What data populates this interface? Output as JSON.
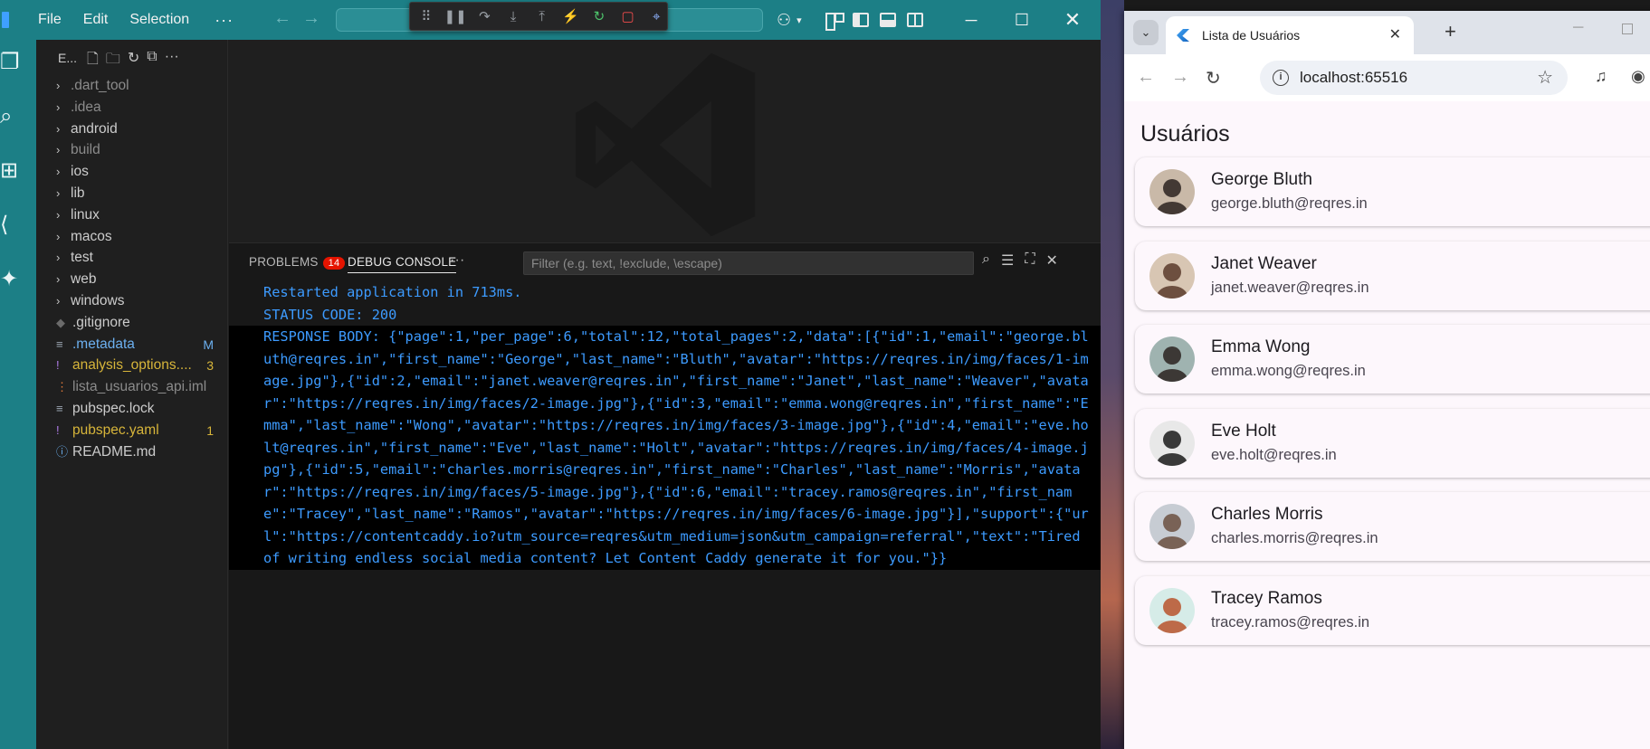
{
  "vscode": {
    "menu": [
      "File",
      "Edit",
      "Selection"
    ],
    "explorer_title": "E...",
    "tree": [
      {
        "label": ".dart_tool",
        "kind": "folder",
        "state": "dim"
      },
      {
        "label": ".idea",
        "kind": "folder",
        "state": "dim"
      },
      {
        "label": "android",
        "kind": "folder",
        "state": ""
      },
      {
        "label": "build",
        "kind": "folder",
        "state": "dim"
      },
      {
        "label": "ios",
        "kind": "folder",
        "state": ""
      },
      {
        "label": "lib",
        "kind": "folder",
        "state": ""
      },
      {
        "label": "linux",
        "kind": "folder",
        "state": ""
      },
      {
        "label": "macos",
        "kind": "folder",
        "state": ""
      },
      {
        "label": "test",
        "kind": "folder",
        "state": ""
      },
      {
        "label": "web",
        "kind": "folder",
        "state": ""
      },
      {
        "label": "windows",
        "kind": "folder",
        "state": ""
      },
      {
        "label": ".gitignore",
        "kind": "file",
        "icon": "diamond-icon",
        "state": ""
      },
      {
        "label": ".metadata",
        "kind": "file",
        "icon": "lines-icon",
        "state": "mod",
        "badge": "M"
      },
      {
        "label": "analysis_options....",
        "kind": "file",
        "icon": "exclamation-icon",
        "state": "warn",
        "badge": "3"
      },
      {
        "label": "lista_usuarios_api.iml",
        "kind": "file",
        "icon": "rss-icon",
        "state": "dim"
      },
      {
        "label": "pubspec.lock",
        "kind": "file",
        "icon": "lines-icon",
        "state": ""
      },
      {
        "label": "pubspec.yaml",
        "kind": "file",
        "icon": "exclamation-icon",
        "state": "warn",
        "badge": "1"
      },
      {
        "label": "README.md",
        "kind": "file",
        "icon": "info-icon",
        "state": ""
      }
    ],
    "panel": {
      "problems_label": "PROBLEMS",
      "problems_count": "14",
      "debug_console_label": "DEBUG CONSOLE",
      "filter_placeholder": "Filter (e.g. text, !exclude, \\escape)",
      "console_lines": [
        "Restarted application in 713ms.",
        "STATUS CODE: 200"
      ],
      "response_body": "RESPONSE BODY: {\"page\":1,\"per_page\":6,\"total\":12,\"total_pages\":2,\"data\":[{\"id\":1,\"email\":\"george.bluth@reqres.in\",\"first_name\":\"George\",\"last_name\":\"Bluth\",\"avatar\":\"https://reqres.in/img/faces/1-image.jpg\"},{\"id\":2,\"email\":\"janet.weaver@reqres.in\",\"first_name\":\"Janet\",\"last_name\":\"Weaver\",\"avatar\":\"https://reqres.in/img/faces/2-image.jpg\"},{\"id\":3,\"email\":\"emma.wong@reqres.in\",\"first_name\":\"Emma\",\"last_name\":\"Wong\",\"avatar\":\"https://reqres.in/img/faces/3-image.jpg\"},{\"id\":4,\"email\":\"eve.holt@reqres.in\",\"first_name\":\"Eve\",\"last_name\":\"Holt\",\"avatar\":\"https://reqres.in/img/faces/4-image.jpg\"},{\"id\":5,\"email\":\"charles.morris@reqres.in\",\"first_name\":\"Charles\",\"last_name\":\"Morris\",\"avatar\":\"https://reqres.in/img/faces/5-image.jpg\"},{\"id\":6,\"email\":\"tracey.ramos@reqres.in\",\"first_name\":\"Tracey\",\"last_name\":\"Ramos\",\"avatar\":\"https://reqres.in/img/faces/6-image.jpg\"}],\"support\":{\"url\":\"https://contentcaddy.io?utm_source=reqres&utm_medium=json&utm_campaign=referral\",\"text\":\"Tired of writing endless social media content? Let Content Caddy generate it for you.\"}}"
    },
    "colors": {
      "titlebar": "#1c7f86",
      "console_text": "#3d9bff",
      "error_badge": "#e51400"
    }
  },
  "chrome": {
    "tab_title": "Lista de Usuários",
    "url": "localhost:65516"
  },
  "app": {
    "title": "Usuários",
    "users": [
      {
        "name": "George Bluth",
        "email": "george.bluth@reqres.in"
      },
      {
        "name": "Janet Weaver",
        "email": "janet.weaver@reqres.in"
      },
      {
        "name": "Emma Wong",
        "email": "emma.wong@reqres.in"
      },
      {
        "name": "Eve Holt",
        "email": "eve.holt@reqres.in"
      },
      {
        "name": "Charles Morris",
        "email": "charles.morris@reqres.in"
      },
      {
        "name": "Tracey Ramos",
        "email": "tracey.ramos@reqres.in"
      }
    ]
  }
}
